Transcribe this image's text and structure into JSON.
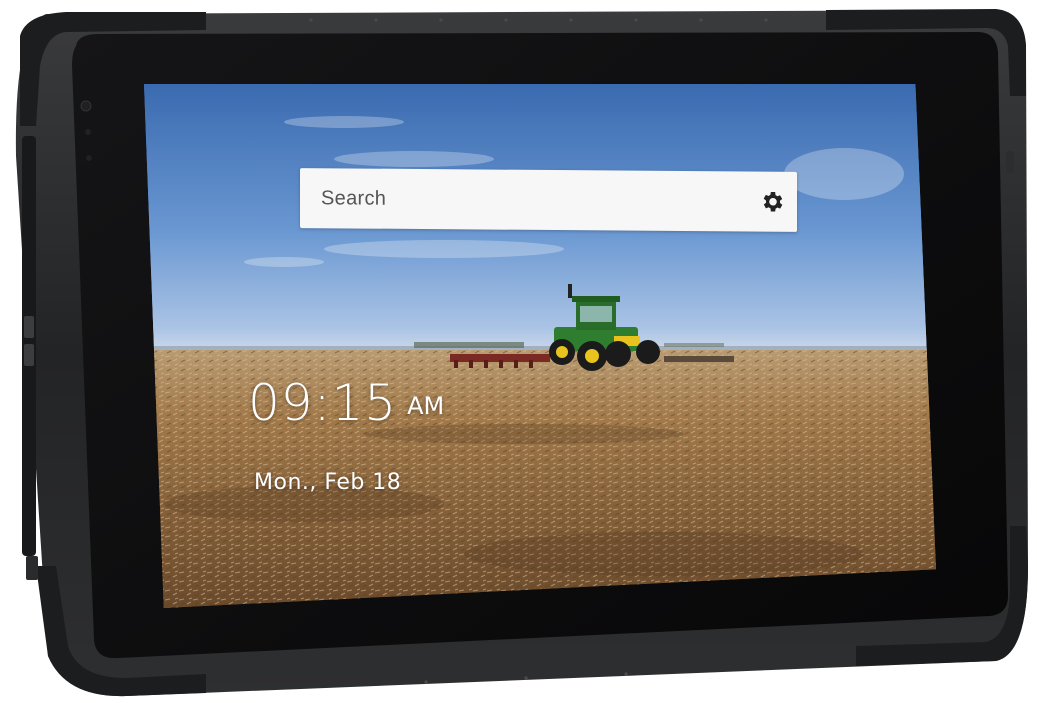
{
  "device": {
    "type": "rugged-tablet",
    "frame_color": "#2b2c2e",
    "bezel_color": "#0d0d0f",
    "accent_color": "#4a4b4d"
  },
  "home_screen": {
    "search": {
      "label": "Search",
      "settings_icon": "gear-icon"
    },
    "clock": {
      "time": "09:15",
      "ampm": "AM"
    },
    "date": "Mon., Feb 18",
    "wallpaper": {
      "scene": "tractor-in-field",
      "sky_color": "#5d8ccb",
      "field_color": "#9c7549",
      "tractor_color": "#2f7d2f"
    }
  }
}
